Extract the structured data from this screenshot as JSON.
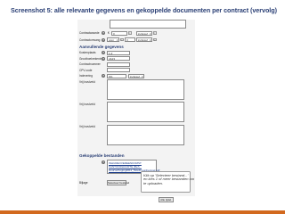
{
  "page": {
    "title": "Screenshot 5:  alle relevante gegevens en gekoppelde documenten per contract (vervolg)"
  },
  "contract": {
    "contractwaarde": {
      "label": "Contractwaarde",
      "value": "0",
      "currency": "€",
      "unit": "inclusief"
    },
    "contractomvang": {
      "label": "Contractomvang",
      "unit_select": "uren",
      "value": "0",
      "unit": "inclusief"
    }
  },
  "extra": {
    "section": "Aanvullende gegevens",
    "fields": [
      {
        "label": "Kostenplaats",
        "value": "1-2"
      },
      {
        "label": "Grootboekrekening",
        "value": "4A23"
      },
      {
        "label": "Contractnummer",
        "value": ""
      },
      {
        "label": "CPV-code",
        "value": ""
      },
      {
        "label": "Indexering",
        "value": "0%",
        "unit": "inclusief"
      },
      {
        "label": "Vrij invulveld",
        "value": ""
      },
      {
        "label": "Vrij invulveld",
        "value": ""
      },
      {
        "label": "Vrij invulveld",
        "value": ""
      }
    ]
  },
  "files": {
    "section": "Gekoppelde bestanden",
    "items": [
      "INHUREOVEREENKOMST",
      "KANTOORHUURTE (Beh...",
      "Huurverhoging2011_Stoelmuurdrempel.pdf"
    ],
    "add_label": "Bijlage",
    "select_button": "Selecteer bestand",
    "callout": "Klik op 'Selecteer bestand...'\nen kies 1 of meer bestanden om\nte uploaden.",
    "cancel_button": "Alle tijdel."
  },
  "colors": {
    "title": "#2a3f75",
    "section": "#2a3f75",
    "accent": "#d2691e"
  }
}
